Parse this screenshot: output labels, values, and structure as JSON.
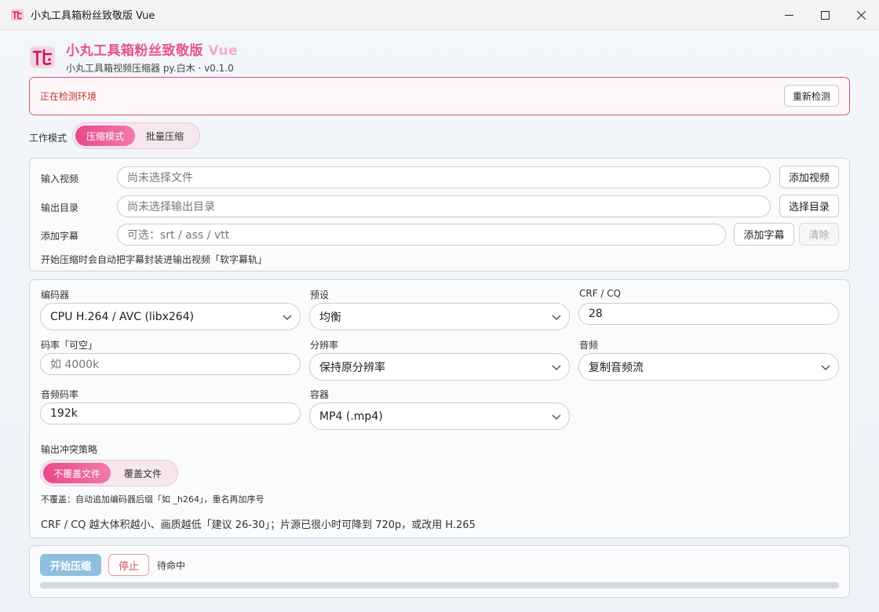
{
  "window": {
    "title": "小丸工具箱粉丝致敬版 Vue"
  },
  "header": {
    "app_name": "小丸工具箱粉丝致敬版",
    "app_name_suffix": "Vue",
    "subtitle": "小丸工具箱视频压缩器 py.白木 · v0.1.0"
  },
  "env": {
    "status": "正在检测环境",
    "recheck_label": "重新检测"
  },
  "mode": {
    "label": "工作模式",
    "options": [
      "压缩模式",
      "批量压缩"
    ],
    "selected": 0
  },
  "files": {
    "input_label": "输入视频",
    "input_placeholder": "尚未选择文件",
    "add_video": "添加视频",
    "output_label": "输出目录",
    "output_placeholder": "尚未选择输出目录",
    "choose_dir": "选择目录",
    "subtitle_label": "添加字幕",
    "subtitle_placeholder": "可选：srt / ass / vtt",
    "add_subtitle": "添加字幕",
    "clear": "清除",
    "hint": "开始压缩时会自动把字幕封装进输出视频「软字幕轨」"
  },
  "settings": {
    "encoder_label": "编码器",
    "encoder_value": "CPU H.264 / AVC (libx264)",
    "preset_label": "预设",
    "preset_value": "均衡",
    "crf_label": "CRF / CQ",
    "crf_value": "28",
    "bitrate_label": "码率「可空」",
    "bitrate_placeholder": "如 4000k",
    "resolution_label": "分辨率",
    "resolution_value": "保持原分辨率",
    "audio_label": "音频",
    "audio_value": "复制音频流",
    "audio_bitrate_label": "音频码率",
    "audio_bitrate_value": "192k",
    "container_label": "容器",
    "container_value": "MP4 (.mp4)",
    "conflict_label": "输出冲突策略",
    "conflict_options": [
      "不覆盖文件",
      "覆盖文件"
    ],
    "conflict_selected": 0,
    "conflict_hint": "不覆盖：自动追加编码器后缀「如 _h264」，重名再加序号",
    "crf_hint": "CRF / CQ 越大体积越小、画质越低「建议 26-30」；片源已很小时可降到 720p，或改用 H.265"
  },
  "actions": {
    "start": "开始压缩",
    "stop": "停止",
    "status": "待命中",
    "progress": 0
  },
  "colors": {
    "accent": "#e8528d",
    "accent_light": "#f7a9c7",
    "primary_disabled": "#8fbfe0",
    "danger": "#c7302f"
  }
}
